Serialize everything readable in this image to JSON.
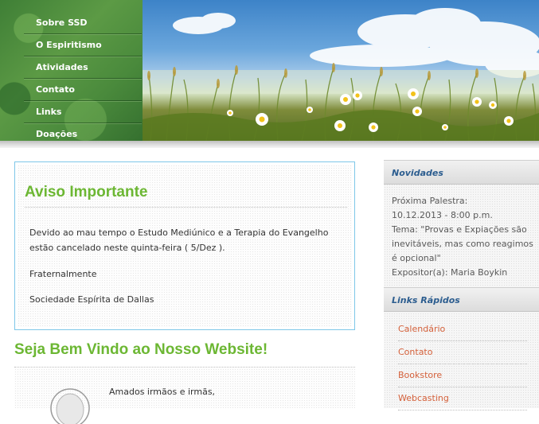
{
  "nav": {
    "items": [
      {
        "label": "Sobre SSD"
      },
      {
        "label": "O Espiritismo"
      },
      {
        "label": "Atividades"
      },
      {
        "label": "Contato"
      },
      {
        "label": "Links"
      },
      {
        "label": "Doações"
      }
    ]
  },
  "aviso": {
    "title": "Aviso Importante",
    "paragraph1": "Devido ao mau tempo o Estudo Mediúnico e a Terapia do Evangelho",
    "paragraph1b": "estão cancelado neste quinta-feira ( 5/Dez ).",
    "paragraph2": "Fraternalmente",
    "paragraph3": "Sociedade Espírita de Dallas"
  },
  "welcome": {
    "title": "Seja Bem Vindo ao Nosso Website!",
    "greeting": "Amados irmãos e irmãs,"
  },
  "sidebar": {
    "news": {
      "heading": "Novidades",
      "lines": [
        "Próxima Palestra:",
        "10.12.2013 - 8:00 p.m.",
        "Tema: \"Provas e Expiações são",
        "inevitáveis, mas como reagimos",
        "é opcional\"",
        "Expositor(a): Maria Boykin"
      ]
    },
    "quick_links": {
      "heading": "Links Rápidos",
      "items": [
        {
          "label": "Calendário"
        },
        {
          "label": "Contato"
        },
        {
          "label": "Bookstore"
        },
        {
          "label": "Webcasting"
        }
      ]
    }
  },
  "colors": {
    "title_green": "#6cb733",
    "nav_green": "#4a8a3c",
    "link_orange": "#d4603a",
    "sidebar_heading_blue": "#2c5d8f",
    "box_border": "#7ec7e8"
  }
}
